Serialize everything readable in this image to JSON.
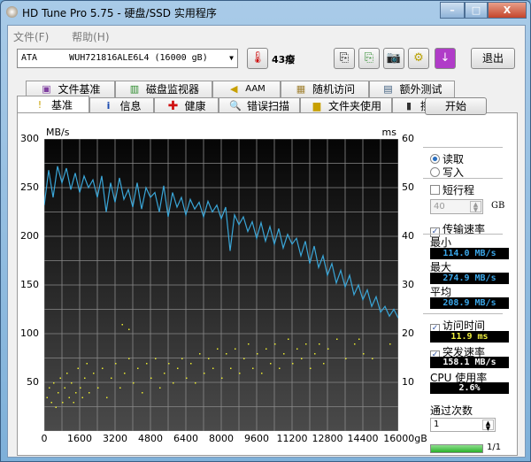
{
  "window": {
    "title": "HD Tune Pro 5.75 - 硬盘/SSD 实用程序",
    "minimize": "–",
    "maximize": "□",
    "close": "X"
  },
  "menu": [
    "文件(F)",
    "帮助(H)"
  ],
  "toolbar": {
    "drive": "ATA      WUH721816ALE6L4 (16000 gB)",
    "temperature": "43癈",
    "exit": "退出"
  },
  "tabs_top": [
    {
      "label": "文件基准",
      "icon": "file-benchmark-icon"
    },
    {
      "label": "磁盘监视器",
      "icon": "disk-monitor-icon"
    },
    {
      "label": "AAM",
      "icon": "speaker-icon"
    },
    {
      "label": "随机访问",
      "icon": "random-access-icon"
    },
    {
      "label": "额外测试",
      "icon": "extra-tests-icon"
    }
  ],
  "tabs_bottom": [
    {
      "label": "基准",
      "icon": "benchmark-icon"
    },
    {
      "label": "信息",
      "icon": "info-icon"
    },
    {
      "label": "健康",
      "icon": "health-icon"
    },
    {
      "label": "错误扫描",
      "icon": "error-scan-icon"
    },
    {
      "label": "文件夹使用",
      "icon": "folder-icon"
    },
    {
      "label": "擦除",
      "icon": "erase-icon"
    }
  ],
  "side": {
    "start": "开始",
    "read": "读取",
    "write": "写入",
    "short_stroke": "短行程",
    "short_value": "40",
    "gb": "GB",
    "transfer_rate": "传输速率",
    "min_label": "最小",
    "min": "114.0 MB/s",
    "max_label": "最大",
    "max": "274.9 MB/s",
    "avg_label": "平均",
    "avg": "208.9 MB/s",
    "access_label": "访问时间",
    "access": "11.9 ms",
    "burst_label": "突发速率",
    "burst": "158.1 MB/s",
    "cpu_label": "CPU 使用率",
    "cpu": "2.6%",
    "passes_label": "通过次数",
    "passes": "1",
    "progress": "1/1",
    "progress_fraction": 1.0
  },
  "colors": {
    "transfer": "#3aa6d8",
    "access": "#e8e830",
    "plot_bg": "#1a1a1a",
    "grid": "#8a8a8a"
  },
  "chart_data": {
    "type": "line",
    "ylabel_left": "MB/s",
    "ylabel_right": "ms",
    "xunit": "gB",
    "ylim_left": [
      0,
      300
    ],
    "ylim_right": [
      0,
      60
    ],
    "xlim": [
      0,
      16000
    ],
    "yticks_left": [
      "300",
      "250",
      "200",
      "150",
      "100",
      "50"
    ],
    "yticks_right": [
      "60",
      "50",
      "40",
      "30",
      "20",
      "10"
    ],
    "xticks": [
      "0",
      "1600",
      "3200",
      "4800",
      "6400",
      "8000",
      "9600",
      "11200",
      "12800",
      "14400",
      "16000gB"
    ],
    "transfer_x_step": 200,
    "transfer_mbps": [
      232,
      268,
      240,
      272,
      255,
      270,
      248,
      265,
      245,
      262,
      250,
      258,
      240,
      262,
      225,
      255,
      235,
      260,
      238,
      248,
      230,
      255,
      228,
      250,
      240,
      245,
      225,
      252,
      220,
      245,
      230,
      240,
      222,
      238,
      228,
      235,
      220,
      236,
      225,
      232,
      218,
      230,
      185,
      222,
      212,
      220,
      205,
      215,
      198,
      214,
      195,
      210,
      192,
      208,
      188,
      202,
      192,
      198,
      180,
      195,
      172,
      190,
      168,
      180,
      160,
      172,
      152,
      165,
      148,
      160,
      140,
      150,
      135,
      145,
      128,
      138,
      122,
      128,
      118,
      125,
      116
    ],
    "access_ms": [
      [
        100,
        7
      ],
      [
        200,
        9
      ],
      [
        300,
        6
      ],
      [
        400,
        10
      ],
      [
        500,
        5
      ],
      [
        600,
        8
      ],
      [
        700,
        11
      ],
      [
        800,
        6
      ],
      [
        900,
        9
      ],
      [
        1000,
        12
      ],
      [
        1100,
        7
      ],
      [
        1200,
        10
      ],
      [
        1300,
        6
      ],
      [
        1400,
        8
      ],
      [
        1500,
        13
      ],
      [
        1600,
        9
      ],
      [
        1700,
        7
      ],
      [
        1800,
        11
      ],
      [
        1900,
        14
      ],
      [
        2000,
        8
      ],
      [
        2200,
        12
      ],
      [
        2400,
        9
      ],
      [
        2600,
        13
      ],
      [
        2800,
        7
      ],
      [
        3000,
        11
      ],
      [
        3200,
        14
      ],
      [
        3400,
        9
      ],
      [
        3600,
        12
      ],
      [
        3800,
        15
      ],
      [
        4000,
        10
      ],
      [
        4200,
        13
      ],
      [
        4400,
        8
      ],
      [
        4600,
        14
      ],
      [
        4800,
        11
      ],
      [
        5000,
        15
      ],
      [
        5200,
        9
      ],
      [
        5400,
        12
      ],
      [
        5600,
        14
      ],
      [
        5800,
        10
      ],
      [
        6000,
        13
      ],
      [
        6200,
        15
      ],
      [
        6400,
        11
      ],
      [
        6600,
        14
      ],
      [
        6800,
        10
      ],
      [
        7000,
        16
      ],
      [
        7200,
        12
      ],
      [
        7400,
        15
      ],
      [
        7600,
        13
      ],
      [
        7800,
        17
      ],
      [
        8000,
        11
      ],
      [
        8200,
        16
      ],
      [
        8400,
        13
      ],
      [
        8600,
        17
      ],
      [
        8800,
        12
      ],
      [
        9000,
        15
      ],
      [
        9200,
        18
      ],
      [
        9400,
        13
      ],
      [
        9600,
        16
      ],
      [
        9800,
        12
      ],
      [
        10000,
        17
      ],
      [
        10200,
        14
      ],
      [
        10400,
        18
      ],
      [
        10600,
        13
      ],
      [
        10800,
        16
      ],
      [
        11000,
        19
      ],
      [
        11200,
        14
      ],
      [
        11400,
        17
      ],
      [
        11600,
        15
      ],
      [
        11800,
        18
      ],
      [
        12000,
        13
      ],
      [
        12200,
        16
      ],
      [
        12400,
        18
      ],
      [
        12600,
        14
      ],
      [
        12800,
        17
      ],
      [
        13200,
        19
      ],
      [
        13600,
        15
      ],
      [
        14000,
        18
      ],
      [
        14400,
        16
      ],
      [
        14800,
        15
      ],
      [
        15600,
        18
      ],
      [
        3500,
        22
      ],
      [
        3800,
        21
      ],
      [
        14200,
        19
      ]
    ]
  }
}
